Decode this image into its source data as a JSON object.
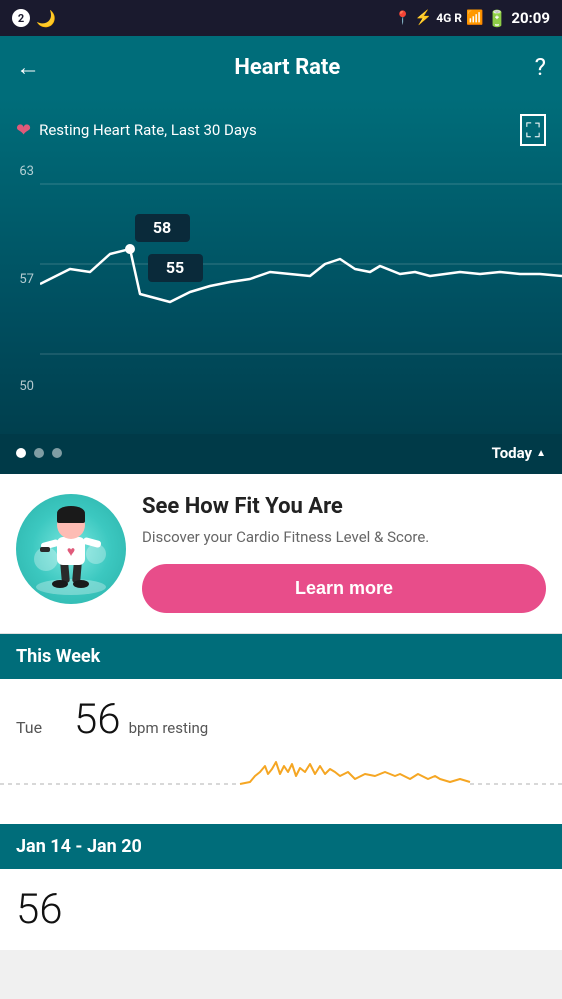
{
  "statusBar": {
    "leftIcons": [
      "circle-icon",
      "moon-icon"
    ],
    "rightIcons": [
      "location-icon",
      "bluetooth-icon",
      "signal-icon",
      "battery-icon"
    ],
    "network": "4G R",
    "time": "20:09"
  },
  "header": {
    "title": "Heart Rate",
    "backLabel": "←",
    "helpLabel": "?"
  },
  "chart": {
    "subtitle": "Resting Heart Rate, Last 30 Days",
    "yLabels": [
      "63",
      "57",
      "50"
    ],
    "tooltip1": "58",
    "tooltip2": "55",
    "todayLabel": "Today",
    "dots": [
      true,
      false,
      false
    ]
  },
  "fitnessCard": {
    "title": "See How Fit You Are",
    "description": "Discover your Cardio Fitness Level & Score.",
    "buttonLabel": "Learn more"
  },
  "thisWeek": {
    "label": "This Week",
    "dayLabel": "Tue",
    "bpm": "56",
    "unit": "bpm resting"
  },
  "dateRange": {
    "label": "Jan 14 - Jan 20",
    "bpm": "56"
  }
}
